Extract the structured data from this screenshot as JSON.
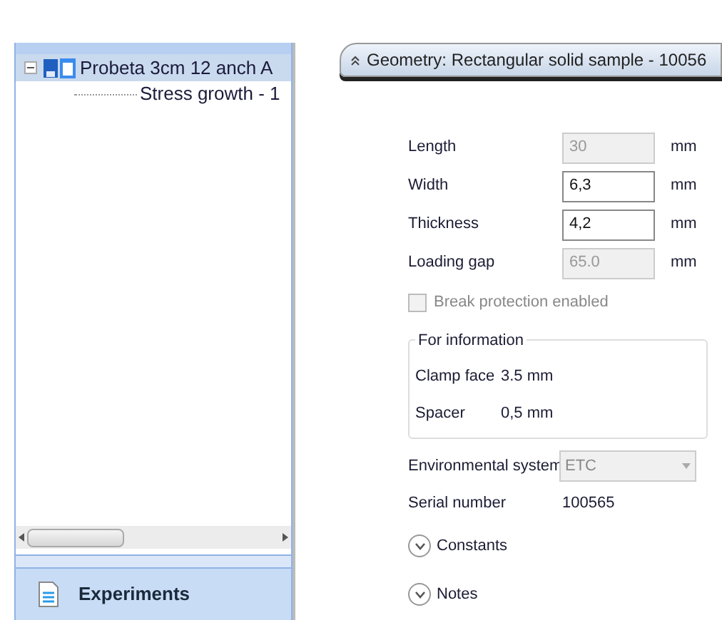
{
  "tree": {
    "items": [
      {
        "label": "Probeta 3cm 12 anch A",
        "selected": true,
        "expanded": true,
        "children": [
          {
            "label": "Stress growth - 1",
            "selected": false
          }
        ]
      }
    ]
  },
  "sidebar_footer": {
    "label": "Experiments"
  },
  "panel": {
    "title": "Geometry: Rectangular solid sample  - 10056",
    "fields": [
      {
        "label": "Length",
        "value": "30",
        "unit": "mm",
        "disabled": true
      },
      {
        "label": "Width",
        "value": "6,3",
        "unit": "mm",
        "disabled": false
      },
      {
        "label": "Thickness",
        "value": "4,2",
        "unit": "mm",
        "disabled": false
      },
      {
        "label": "Loading gap",
        "value": "65.0",
        "unit": "mm",
        "disabled": true
      }
    ],
    "break_protection": {
      "label": "Break protection enabled",
      "checked": false,
      "disabled": true
    },
    "info": {
      "title": "For information",
      "rows": [
        {
          "label": "Clamp face",
          "value": "3.5 mm"
        },
        {
          "label": "Spacer",
          "value": "0,5 mm"
        }
      ]
    },
    "environmental_system": {
      "label": "Environmental system",
      "value": "ETC"
    },
    "serial_number": {
      "label": "Serial number",
      "value": "100565"
    },
    "sections": [
      {
        "label": "Constants",
        "expanded": false
      },
      {
        "label": "Notes",
        "expanded": false
      }
    ]
  }
}
